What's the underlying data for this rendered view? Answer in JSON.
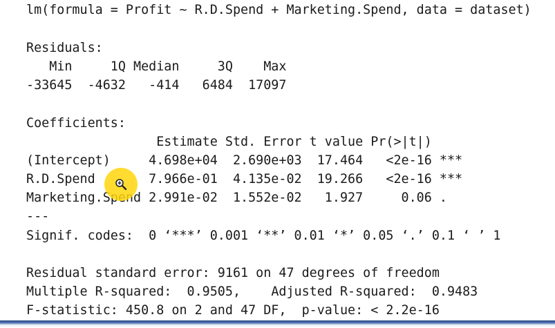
{
  "console": {
    "lines": [
      "lm(formula = Profit ~ R.D.Spend + Marketing.Spend, data = dataset)",
      "Residuals:",
      "   Min     1Q Median     3Q    Max ",
      "-33645  -4632   -414   6484  17097 ",
      "Coefficients:",
      "                 Estimate Std. Error t value Pr(>|t|)    ",
      "(Intercept)     4.698e+04  2.690e+03  17.464   <2e-16 ***",
      "R.D.Spend       7.966e-01  4.135e-02  19.266   <2e-16 ***",
      "Marketing.Spend 2.991e-02  1.552e-02   1.927     0.06 .  ",
      "---",
      "Signif. codes:  0 ‘***’ 0.001 ‘**’ 0.01 ‘*’ 0.05 ‘.’ 0.1 ‘ ’ 1",
      "Residual standard error: 9161 on 47 degrees of freedom",
      "Multiple R-squared:  0.9505,\tAdjusted R-squared:  0.9483 ",
      "F-statistic: 450.8 on 2 and 47 DF,  p-value: < 2.2e-16"
    ]
  },
  "cursor": {
    "icon": "zoom-in-cursor-icon",
    "highlight_color": "#FFD60A"
  },
  "colors": {
    "background": "#FFFFFF",
    "text": "#1A1A1A",
    "bottom_rule": "#2D4B86"
  }
}
